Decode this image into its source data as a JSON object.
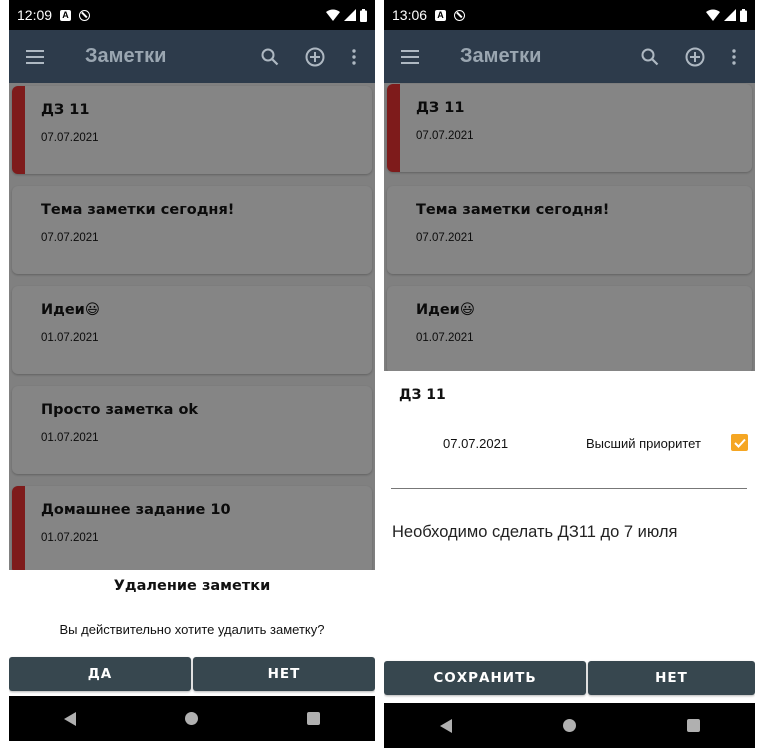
{
  "left": {
    "status_time": "12:09",
    "app_title": "Заметки",
    "notes": [
      {
        "title": "ДЗ 11",
        "date": "07.07.2021",
        "priority": true
      },
      {
        "title": "Тема заметки сегодня!",
        "date": "07.07.2021",
        "priority": false
      },
      {
        "title": "Идеи😃",
        "date": "01.07.2021",
        "priority": false
      },
      {
        "title": "Просто заметка ok",
        "date": "01.07.2021",
        "priority": false
      },
      {
        "title": "Домашнее задание 10",
        "date": "01.07.2021",
        "priority": true
      }
    ],
    "dialog": {
      "title": "Удаление заметки",
      "message": "Вы действительно хотите удалить заметку?",
      "yes_label": "ДА",
      "no_label": "НЕТ"
    }
  },
  "right": {
    "status_time": "13:06",
    "app_title": "Заметки",
    "notes": [
      {
        "title": "ДЗ 11",
        "date": "07.07.2021",
        "priority": true
      },
      {
        "title": "Тема заметки сегодня!",
        "date": "07.07.2021",
        "priority": false
      },
      {
        "title": "Идеи😃",
        "date": "01.07.2021",
        "priority": false
      }
    ],
    "editor": {
      "title": "ДЗ 11",
      "date": "07.07.2021",
      "priority_label": "Высший приоритет",
      "priority_checked": true,
      "body": "Необходимо сделать ДЗ11 до 7 июля",
      "save_label": "СОХРАНИТЬ",
      "no_label": "НЕТ"
    }
  },
  "colors": {
    "appbar": "#2d3b4b",
    "button": "#37474f",
    "priority_marker": "#7e1b1b",
    "checkbox": "#f5a623"
  },
  "icons": [
    "menu-icon",
    "search-icon",
    "add-circle-icon",
    "more-vert-icon",
    "wifi-icon",
    "signal-icon",
    "battery-icon",
    "back-icon",
    "home-icon",
    "recents-icon"
  ]
}
